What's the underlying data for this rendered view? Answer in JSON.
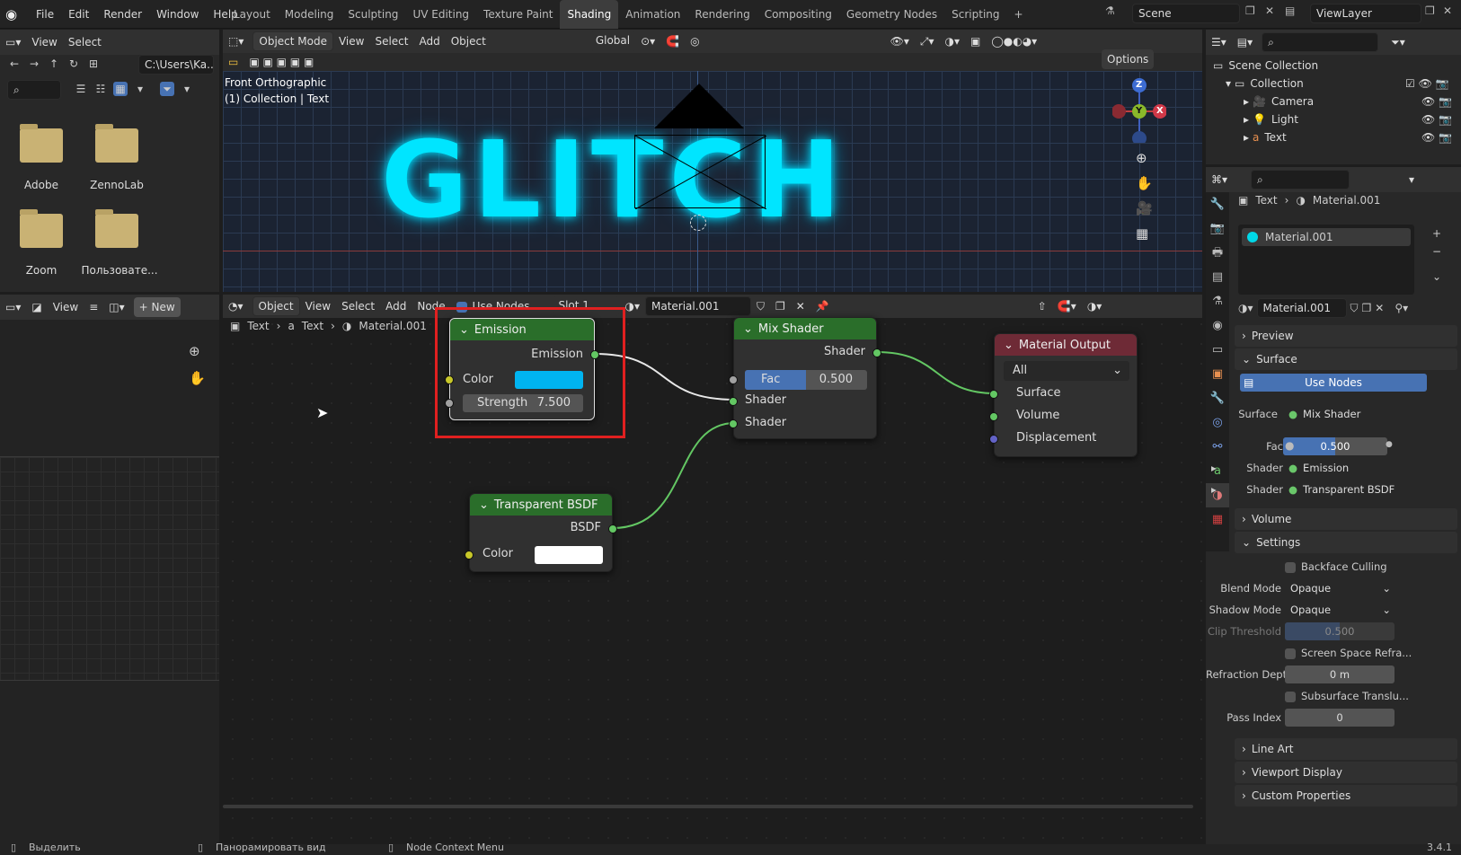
{
  "menu": {
    "items": [
      "File",
      "Edit",
      "Render",
      "Window",
      "Help"
    ]
  },
  "workspaces": {
    "tabs": [
      "Layout",
      "Modeling",
      "Sculpting",
      "UV Editing",
      "Texture Paint",
      "Shading",
      "Animation",
      "Rendering",
      "Compositing",
      "Geometry Nodes",
      "Scripting"
    ],
    "active": "Shading",
    "add": "+"
  },
  "scene": {
    "name": "Scene"
  },
  "viewlayer": {
    "name": "ViewLayer"
  },
  "file_browser": {
    "header": [
      "View",
      "Select"
    ],
    "path": "C:\\Users\\Ka...",
    "folders": [
      "Adobe",
      "ZennoLab",
      "Zoom",
      "Пользовате..."
    ]
  },
  "image_editor": {
    "view": "View",
    "new_label": "New"
  },
  "viewport": {
    "mode": "Object Mode",
    "menus": [
      "View",
      "Select",
      "Add",
      "Object"
    ],
    "orientation": "Global",
    "options": "Options",
    "overlay_title": "Front Orthographic",
    "overlay_sub": "(1) Collection | Text",
    "scene_text": "GLITCH",
    "text_color": "#00e5ff",
    "gizmo": {
      "z": "Z",
      "y": "Y",
      "x": "X"
    }
  },
  "node_editor": {
    "type": "Object",
    "menus": [
      "View",
      "Select",
      "Add",
      "Node"
    ],
    "use_nodes": "Use Nodes",
    "slot": "Slot 1",
    "material": "Material.001",
    "breadcrumb": [
      "Text",
      "Text",
      "Material.001"
    ],
    "nodes": {
      "emission": {
        "title": "Emission",
        "output": "Emission",
        "color_label": "Color",
        "strength_label": "Strength",
        "strength": "7.500",
        "color": "#00b4f0"
      },
      "mix": {
        "title": "Mix Shader",
        "output": "Shader",
        "fac_label": "Fac",
        "fac": "0.500",
        "in1": "Shader",
        "in2": "Shader"
      },
      "output": {
        "title": "Material Output",
        "target": "All",
        "in1": "Surface",
        "in2": "Volume",
        "in3": "Displacement"
      },
      "transparent": {
        "title": "Transparent BSDF",
        "output": "BSDF",
        "color_label": "Color"
      }
    },
    "highlight_color": "#e02020"
  },
  "outliner": {
    "title": "Scene Collection",
    "items": [
      "Collection",
      "Camera",
      "Light",
      "Text"
    ]
  },
  "properties": {
    "breadcrumb": [
      "Text",
      "Material.001"
    ],
    "slot": "Material.001",
    "material_name": "Material.001",
    "sections": {
      "preview": "Preview",
      "surface": "Surface",
      "volume": "Volume",
      "settings": "Settings",
      "line_art": "Line Art",
      "viewport_display": "Viewport Display",
      "custom_props": "Custom Properties"
    },
    "use_nodes": "Use Nodes",
    "surface_label": "Surface",
    "surface_value": "Mix Shader",
    "fac_label": "Fac",
    "fac_value": "0.500",
    "shader1_label": "Shader",
    "shader1_value": "Emission",
    "shader2_label": "Shader",
    "shader2_value": "Transparent BSDF",
    "backface": "Backface Culling",
    "blend_label": "Blend Mode",
    "blend_value": "Opaque",
    "shadow_label": "Shadow Mode",
    "shadow_value": "Opaque",
    "clip_label": "Clip Threshold",
    "clip_value": "0.500",
    "ssr": "Screen Space Refra...",
    "refr_label": "Refraction Depth",
    "refr_value": "0 m",
    "sss": "Subsurface Translu...",
    "pass_label": "Pass Index",
    "pass_value": "0"
  },
  "status": {
    "left": "Выделить",
    "mid": "Панорамировать вид",
    "right": "Node Context Menu",
    "version": "3.4.1"
  }
}
